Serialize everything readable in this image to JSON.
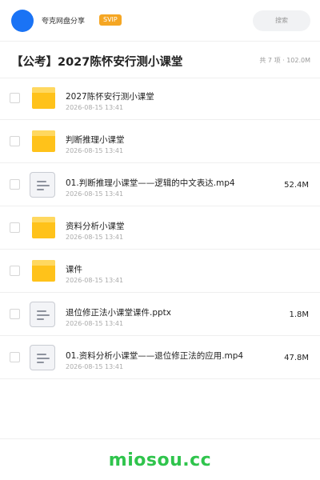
{
  "topbar": {
    "username": "夸克网盘分享",
    "badge": "SVIP",
    "search_placeholder": "搜索"
  },
  "header": {
    "title": "【公考】2027陈怀安行测小课堂",
    "summary": "共 7 项 · 102.0M"
  },
  "files": [
    {
      "name": "2027陈怀安行测小课堂",
      "date": "2026-08-15 13:41",
      "size": "",
      "type": "folder-icon"
    },
    {
      "name": "判断推理小课堂",
      "date": "2026-08-15 13:41",
      "size": "",
      "type": "folder-icon"
    },
    {
      "name": "01.判断推理小课堂——逻辑的中文表达.mp4",
      "date": "2026-08-15 13:41",
      "size": "52.4M",
      "type": "document-icon"
    },
    {
      "name": "资料分析小课堂",
      "date": "2026-08-15 13:41",
      "size": "",
      "type": "folder-icon"
    },
    {
      "name": "课件",
      "date": "2026-08-15 13:41",
      "size": "",
      "type": "folder-icon"
    },
    {
      "name": "退位修正法小课堂课件.pptx",
      "date": "2026-08-15 13:41",
      "size": "1.8M",
      "type": "document-icon"
    },
    {
      "name": "01.资料分析小课堂——退位修正法的应用.mp4",
      "date": "2026-08-15 13:41",
      "size": "47.8M",
      "type": "document-icon"
    }
  ],
  "footer": {
    "brand": "miosou.cc"
  },
  "colors": {
    "avatar": "#1a73f5",
    "badge": "#f5a623",
    "folder": "#ffc21a",
    "brand": "#2fc44c"
  }
}
